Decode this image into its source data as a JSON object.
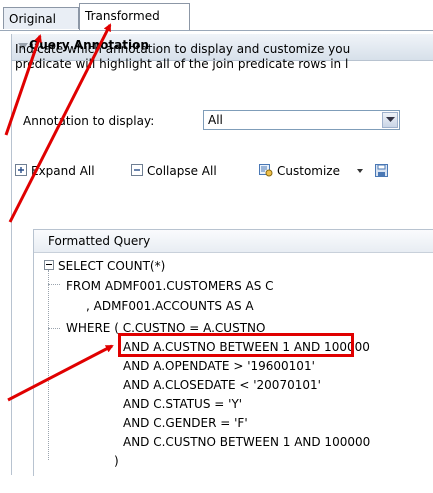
{
  "tabs": [
    {
      "label": "Original",
      "active": false
    },
    {
      "label": "Transformed",
      "active": true
    }
  ],
  "panel": {
    "title": "Query Annotation",
    "description": [
      "Indicate which annotation to display and customize you",
      "predicate will highlight all of the join predicate rows in l"
    ]
  },
  "annotation": {
    "label": "Annotation to display:",
    "selected": "All"
  },
  "toolbar": {
    "expand_all": "Expand All",
    "collapse_all": "Collapse All",
    "customize": "Customize"
  },
  "grid": {
    "header": "Formatted Query",
    "rows": [
      "SELECT COUNT(*)",
      "FROM ADMF001.CUSTOMERS AS C",
      ", ADMF001.ACCOUNTS AS A",
      "WHERE ( C.CUSTNO = A.CUSTNO",
      "AND A.CUSTNO BETWEEN 1 AND 100000",
      "AND A.OPENDATE > '19600101'",
      "AND A.CLOSEDATE < '20070101'",
      "AND C.STATUS = 'Y'",
      "AND C.GENDER = 'F'",
      "AND C.CUSTNO BETWEEN 1 AND 100000",
      ")"
    ]
  },
  "colors": {
    "highlight": "#e00000",
    "arrow": "#e00000"
  }
}
